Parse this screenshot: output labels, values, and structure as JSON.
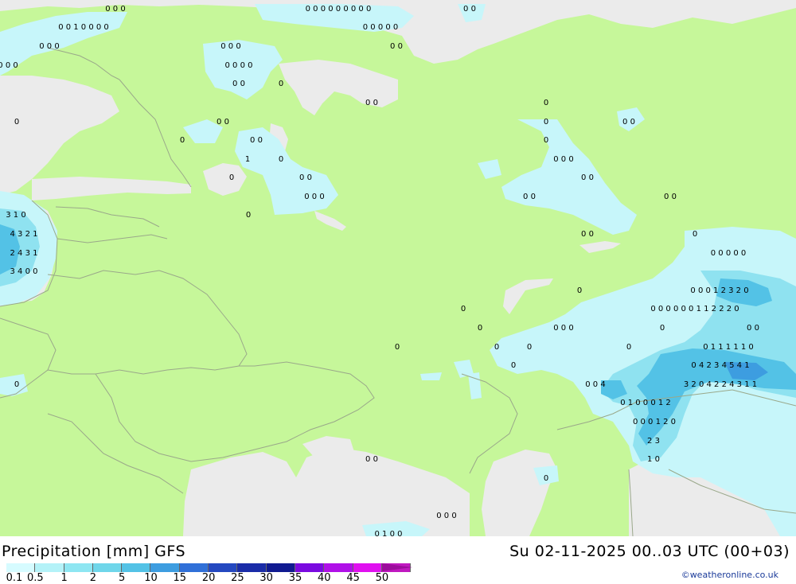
{
  "title": "Precipitation [mm] GFS",
  "valid_time": "Su 02-11-2025 00..03 UTC (00+03)",
  "credit": "©weatheronline.co.uk",
  "colors": {
    "land": "#c6f79a",
    "sea": "#ebebeb",
    "border": "#9aa88a",
    "precip_light": "#c7f6fa",
    "precip_mid": "#8fe2f0",
    "precip_heavy": "#53c2e6"
  },
  "legend": {
    "ticks": [
      "0.1",
      "0.5",
      "1",
      "2",
      "5",
      "10",
      "15",
      "20",
      "25",
      "30",
      "35",
      "40",
      "45",
      "50"
    ],
    "colors": [
      "#d6fbff",
      "#b4f2f8",
      "#8ee6f2",
      "#6fd6ea",
      "#53c2e6",
      "#3d9de0",
      "#3070d8",
      "#2448c0",
      "#1a2ca8",
      "#101a90",
      "#7a0ae0",
      "#b010e8",
      "#e010f0",
      "#c018c0"
    ]
  },
  "map_values": [
    "0 0 0",
    "0 0 0 0 0 0 0 0 0",
    "0 0",
    "0 0 1 0 0 0 0",
    "0 0 0 0 0",
    "0 0 0",
    "0 0 0",
    "0 0",
    "0 0 0",
    "0 0 0 0",
    "0 0",
    "0",
    "0 0",
    "0",
    "0",
    "0 0",
    "0",
    "0 0",
    "1",
    "0",
    "0",
    "0 0",
    "0 0 0",
    "0 0 0",
    "0",
    "0 0",
    "0",
    "0 0",
    "0 0",
    "3 1 0",
    "4 3 2 1",
    "2 4 3 1",
    "3 4 0 0",
    "0",
    "0 0",
    "0 0 0 0 0",
    "0 0",
    "0",
    "0 0 0 1 2 3 2 0",
    "0",
    "0 0 0 0 0 0 1 1 2 2 2 0",
    "0",
    "0 0 0",
    "0",
    "0 0",
    "0",
    "0",
    "0",
    "0 1 1 1 1 1 0",
    "0",
    "0",
    "0 4 2 3 4 5 4 1",
    "0",
    "0 0 4",
    "3 2 0 4 2 2 4 3 1 1",
    "0 1 0 0 0 1 2",
    "0 0 0 1 2 0",
    "2 3",
    "1 0",
    "0",
    "0 0",
    "0",
    "0 0 0",
    "0 1 0 0"
  ]
}
